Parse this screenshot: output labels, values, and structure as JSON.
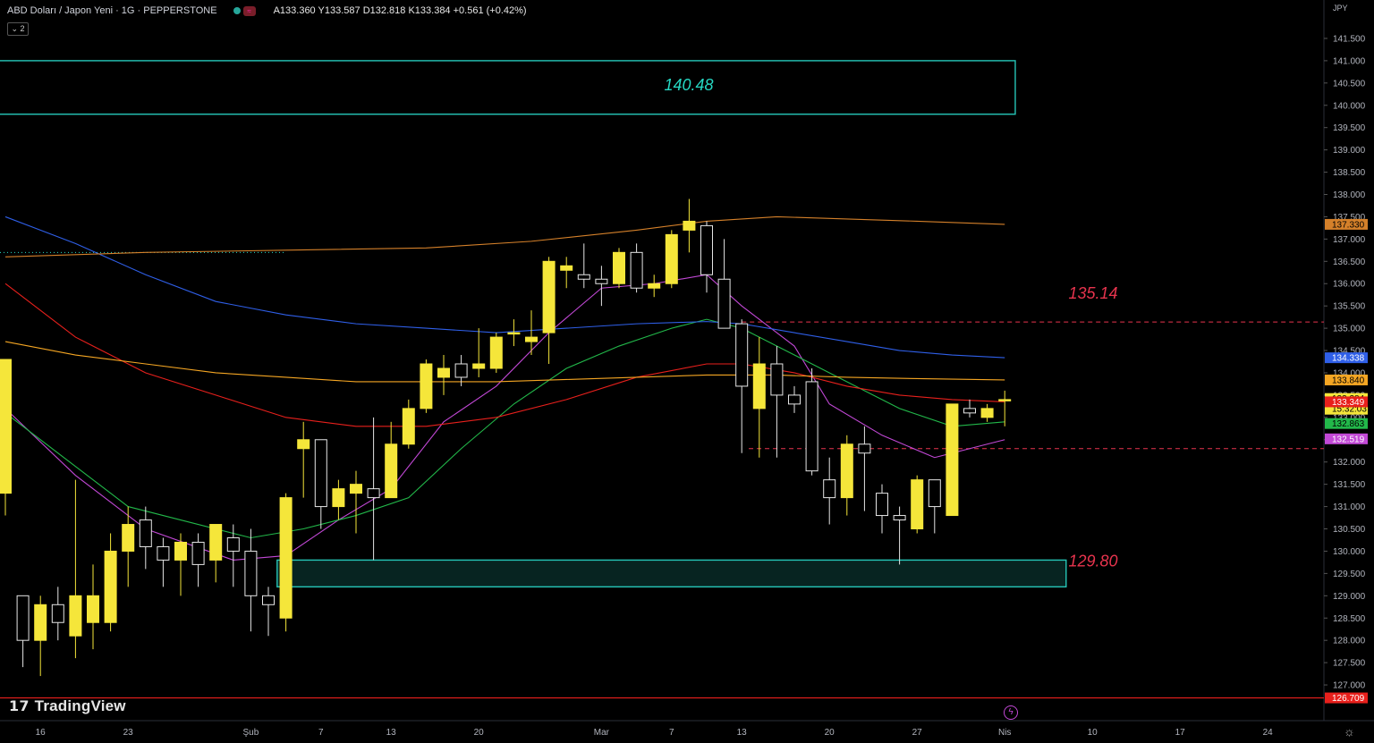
{
  "header": {
    "title": "ABD Doları / Japon Yeni · 1G · PEPPERSTONE",
    "ohlc": "A133.360 Y133.587 D132.818 K133.384 +0.561 (+0.42%)",
    "indicator_count": "2",
    "status_dot_colors": [
      "#26a69a",
      "#555555"
    ],
    "badge": "≈"
  },
  "branding": {
    "logo_text": "TradingView",
    "logo_icon": "tradingview-logo-icon"
  },
  "colors": {
    "bull": "#f5e63a",
    "bear": "#000000",
    "wick": "#e6e6e6",
    "zone": "#26c6b8",
    "label_red": "#e8344e",
    "label_teal": "#26d9c4"
  },
  "chart_data": {
    "type": "candlestick",
    "currency": "JPY",
    "ylim": [
      126.6,
      141.8
    ],
    "y_ticks": [
      127.0,
      127.5,
      128.0,
      128.5,
      129.0,
      129.5,
      130.0,
      130.5,
      131.0,
      131.5,
      132.0,
      132.5,
      133.0,
      133.5,
      134.0,
      134.5,
      135.0,
      135.5,
      136.0,
      136.5,
      137.0,
      137.5,
      138.0,
      138.5,
      139.0,
      139.5,
      140.0,
      140.5,
      141.0,
      141.5
    ],
    "x_ticks": [
      {
        "label": "16",
        "i": 2
      },
      {
        "label": "23",
        "i": 7
      },
      {
        "label": "Şub",
        "i": 14
      },
      {
        "label": "7",
        "i": 18
      },
      {
        "label": "13",
        "i": 22
      },
      {
        "label": "20",
        "i": 27
      },
      {
        "label": "Mar",
        "i": 34
      },
      {
        "label": "7",
        "i": 38
      },
      {
        "label": "13",
        "i": 42
      },
      {
        "label": "20",
        "i": 47
      },
      {
        "label": "27",
        "i": 52
      },
      {
        "label": "Nis",
        "i": 57
      },
      {
        "label": "10",
        "i": 62
      },
      {
        "label": "17",
        "i": 67
      },
      {
        "label": "24",
        "i": 72
      }
    ],
    "candles": [
      [
        131.3,
        134.3,
        130.8,
        134.3
      ],
      [
        129.0,
        128.0,
        127.4,
        129.0
      ],
      [
        128.0,
        128.8,
        127.2,
        129.0
      ],
      [
        128.8,
        128.4,
        128.0,
        129.2
      ],
      [
        128.1,
        129.0,
        127.6,
        131.6
      ],
      [
        128.4,
        129.0,
        127.8,
        129.7
      ],
      [
        128.4,
        130.0,
        128.2,
        130.4
      ],
      [
        130.0,
        130.6,
        129.2,
        131.0
      ],
      [
        130.7,
        130.1,
        129.6,
        131.0
      ],
      [
        130.1,
        129.8,
        129.2,
        130.3
      ],
      [
        129.8,
        130.2,
        129.0,
        130.4
      ],
      [
        130.2,
        129.7,
        129.2,
        130.4
      ],
      [
        129.8,
        130.6,
        129.3,
        130.6
      ],
      [
        130.3,
        130.0,
        129.2,
        130.6
      ],
      [
        130.0,
        129.0,
        128.2,
        130.5
      ],
      [
        129.0,
        128.8,
        128.1,
        129.2
      ],
      [
        128.5,
        131.2,
        128.2,
        131.3
      ],
      [
        132.3,
        132.5,
        131.2,
        132.9
      ],
      [
        132.5,
        131.0,
        130.5,
        132.5
      ],
      [
        131.0,
        131.4,
        130.7,
        131.6
      ],
      [
        131.3,
        131.5,
        130.4,
        131.8
      ],
      [
        131.4,
        131.2,
        129.8,
        133.0
      ],
      [
        131.2,
        132.4,
        131.2,
        132.9
      ],
      [
        132.4,
        133.2,
        132.3,
        133.4
      ],
      [
        133.2,
        134.2,
        133.1,
        134.3
      ],
      [
        133.9,
        134.1,
        133.5,
        134.4
      ],
      [
        134.2,
        133.9,
        133.7,
        134.4
      ],
      [
        134.1,
        134.2,
        133.9,
        135.0
      ],
      [
        134.1,
        134.8,
        134.0,
        134.9
      ],
      [
        134.9,
        134.9,
        134.6,
        135.2
      ],
      [
        134.7,
        134.8,
        134.4,
        135.4
      ],
      [
        134.9,
        136.5,
        134.2,
        136.6
      ],
      [
        136.3,
        136.4,
        135.9,
        136.6
      ],
      [
        136.2,
        136.1,
        135.9,
        136.9
      ],
      [
        136.1,
        136.0,
        135.5,
        136.4
      ],
      [
        136.0,
        136.7,
        135.9,
        136.8
      ],
      [
        136.7,
        135.9,
        135.8,
        136.9
      ],
      [
        135.9,
        136.0,
        135.7,
        136.2
      ],
      [
        136.0,
        137.1,
        135.9,
        137.2
      ],
      [
        137.2,
        137.4,
        136.7,
        137.9
      ],
      [
        137.3,
        136.2,
        135.8,
        137.4
      ],
      [
        136.1,
        135.0,
        135.8,
        137.0
      ],
      [
        135.1,
        133.7,
        132.2,
        135.2
      ],
      [
        133.2,
        134.2,
        132.1,
        134.8
      ],
      [
        134.2,
        133.5,
        132.1,
        134.6
      ],
      [
        133.5,
        133.3,
        133.1,
        133.7
      ],
      [
        133.8,
        131.8,
        131.7,
        134.1
      ],
      [
        131.6,
        131.2,
        130.6,
        132.1
      ],
      [
        131.2,
        132.4,
        130.8,
        132.6
      ],
      [
        132.4,
        132.2,
        130.9,
        132.8
      ],
      [
        131.3,
        130.8,
        130.4,
        131.5
      ],
      [
        130.8,
        130.7,
        129.7,
        131.0
      ],
      [
        130.5,
        131.6,
        130.4,
        131.7
      ],
      [
        131.6,
        131.0,
        130.4,
        131.6
      ],
      [
        130.8,
        133.3,
        130.8,
        133.3
      ],
      [
        133.2,
        133.1,
        133.0,
        133.4
      ],
      [
        133.0,
        133.2,
        132.9,
        133.3
      ],
      [
        133.4,
        133.4,
        132.8,
        133.6
      ]
    ],
    "moving_averages": [
      {
        "color": "#c248d6",
        "values": [
          [
            0,
            133.2
          ],
          [
            4,
            131.7
          ],
          [
            8,
            130.5
          ],
          [
            13,
            129.8
          ],
          [
            16,
            129.9
          ],
          [
            19,
            130.7
          ],
          [
            22,
            131.4
          ],
          [
            25,
            132.9
          ],
          [
            28,
            133.7
          ],
          [
            31,
            134.9
          ],
          [
            34,
            135.9
          ],
          [
            37,
            136.0
          ],
          [
            40,
            136.2
          ],
          [
            42,
            135.5
          ],
          [
            45,
            134.6
          ],
          [
            47,
            133.3
          ],
          [
            50,
            132.6
          ],
          [
            53,
            132.1
          ],
          [
            55,
            132.3
          ],
          [
            57,
            132.5
          ]
        ]
      },
      {
        "color": "#22b84a",
        "values": [
          [
            0,
            133.1
          ],
          [
            4,
            131.9
          ],
          [
            7,
            131.0
          ],
          [
            10,
            130.7
          ],
          [
            14,
            130.3
          ],
          [
            17,
            130.5
          ],
          [
            20,
            130.8
          ],
          [
            23,
            131.2
          ],
          [
            26,
            132.3
          ],
          [
            29,
            133.3
          ],
          [
            32,
            134.1
          ],
          [
            35,
            134.6
          ],
          [
            38,
            135.0
          ],
          [
            40,
            135.2
          ],
          [
            42,
            135.0
          ],
          [
            45,
            134.4
          ],
          [
            48,
            133.8
          ],
          [
            51,
            133.2
          ],
          [
            54,
            132.8
          ],
          [
            57,
            132.9
          ]
        ]
      },
      {
        "color": "#e8201c",
        "values": [
          [
            0,
            136.0
          ],
          [
            4,
            134.8
          ],
          [
            8,
            134.0
          ],
          [
            12,
            133.5
          ],
          [
            16,
            133.0
          ],
          [
            20,
            132.8
          ],
          [
            24,
            132.8
          ],
          [
            28,
            133.0
          ],
          [
            32,
            133.4
          ],
          [
            36,
            133.9
          ],
          [
            40,
            134.2
          ],
          [
            42,
            134.2
          ],
          [
            45,
            134.0
          ],
          [
            48,
            133.7
          ],
          [
            51,
            133.5
          ],
          [
            54,
            133.4
          ],
          [
            57,
            133.35
          ]
        ]
      },
      {
        "color": "#2f5fe8",
        "values": [
          [
            0,
            137.5
          ],
          [
            4,
            136.9
          ],
          [
            8,
            136.2
          ],
          [
            12,
            135.6
          ],
          [
            16,
            135.3
          ],
          [
            20,
            135.1
          ],
          [
            24,
            135.0
          ],
          [
            28,
            134.9
          ],
          [
            32,
            135.0
          ],
          [
            36,
            135.1
          ],
          [
            40,
            135.15
          ],
          [
            42,
            135.1
          ],
          [
            45,
            134.9
          ],
          [
            48,
            134.7
          ],
          [
            51,
            134.5
          ],
          [
            54,
            134.4
          ],
          [
            57,
            134.34
          ]
        ]
      },
      {
        "color": "#f5a623",
        "values": [
          [
            0,
            134.7
          ],
          [
            4,
            134.4
          ],
          [
            8,
            134.2
          ],
          [
            12,
            134.0
          ],
          [
            16,
            133.9
          ],
          [
            20,
            133.8
          ],
          [
            24,
            133.8
          ],
          [
            28,
            133.8
          ],
          [
            32,
            133.85
          ],
          [
            36,
            133.9
          ],
          [
            40,
            133.95
          ],
          [
            44,
            133.95
          ],
          [
            48,
            133.9
          ],
          [
            52,
            133.87
          ],
          [
            57,
            133.84
          ]
        ]
      },
      {
        "color": "#d4802a",
        "values": [
          [
            0,
            136.6
          ],
          [
            8,
            136.7
          ],
          [
            16,
            136.75
          ],
          [
            24,
            136.8
          ],
          [
            30,
            136.95
          ],
          [
            36,
            137.2
          ],
          [
            40,
            137.4
          ],
          [
            44,
            137.5
          ],
          [
            48,
            137.45
          ],
          [
            52,
            137.4
          ],
          [
            57,
            137.33
          ]
        ]
      }
    ],
    "price_badges": [
      {
        "label": "137.330",
        "color": "#d4802a"
      },
      {
        "label": "134.338",
        "color": "#2f5fe8"
      },
      {
        "label": "133.840",
        "color": "#f5a623"
      },
      {
        "label": "133.384",
        "label2": "15:32:03",
        "color": "#f5e63a"
      },
      {
        "label": "133.349",
        "color": "#e8201c"
      },
      {
        "label": "132.863",
        "color": "#22b84a"
      },
      {
        "label": "132.519",
        "color": "#c248d6"
      },
      {
        "label": "126.709",
        "color": "#e8201c"
      }
    ],
    "annotations": [
      {
        "text": "140.48",
        "color": "#26d9c4"
      },
      {
        "text": "135.14",
        "color": "#e8344e"
      },
      {
        "text": "129.80",
        "color": "#e8344e"
      }
    ],
    "zones": [
      {
        "y_low": 139.8,
        "y_high": 141.0,
        "x_start": -2,
        "x_end": 57.6,
        "color": "#26c6b8"
      },
      {
        "y_low": 129.2,
        "y_high": 129.8,
        "x_start": 15.5,
        "x_end": 60.5,
        "color": "#26c6b8"
      }
    ],
    "levels": [
      {
        "y": 135.14,
        "x_start": 42,
        "color": "#e8344e",
        "style": "dashed"
      },
      {
        "y": 132.3,
        "x_start": 42.4,
        "color": "#e8344e",
        "style": "dashed"
      },
      {
        "y": 126.709,
        "x_start": -2,
        "color": "#e8201c",
        "style": "solid"
      },
      {
        "y": 136.7,
        "x_start": -2,
        "x_end": 16,
        "color": "#26d9c4",
        "style": "dotted"
      }
    ]
  }
}
